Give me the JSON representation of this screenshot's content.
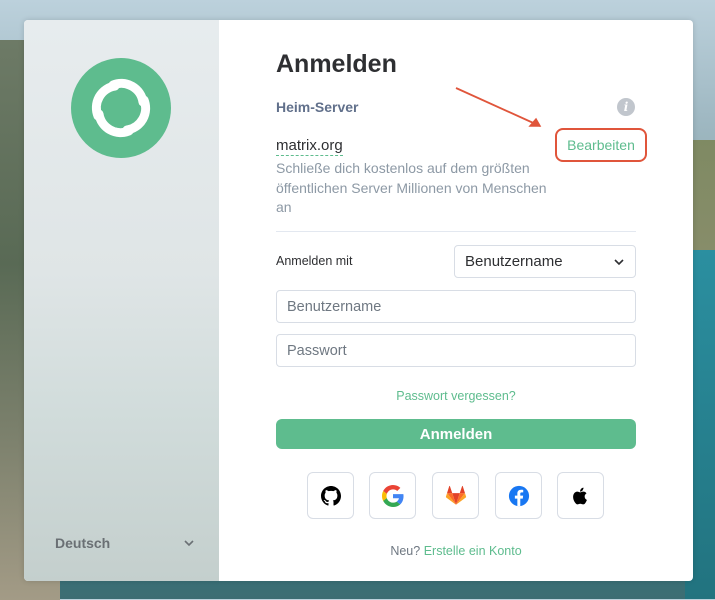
{
  "sidebar": {
    "logo_icon": "element-logo-icon",
    "language": "Deutsch"
  },
  "login": {
    "title": "Anmelden",
    "homeserver_label": "Heim-Server",
    "info_icon": "info-icon",
    "server_name": "matrix.org",
    "server_description": "Schließe dich kostenlos auf dem größten öffentlichen Server Millionen von Menschen an",
    "edit_label": "Bearbeiten",
    "login_with_label": "Anmelden mit",
    "login_method": "Benutzername",
    "username_placeholder": "Benutzername",
    "password_placeholder": "Passwort",
    "forgot_password": "Passwort vergessen?",
    "submit_label": "Anmelden",
    "sso_providers": [
      "github-icon",
      "google-icon",
      "gitlab-icon",
      "facebook-icon",
      "apple-icon"
    ],
    "register_prefix": "Neu?",
    "register_link": "Erstelle ein Konto"
  },
  "colors": {
    "accent": "#5ebc8e",
    "highlight": "#e0553b"
  }
}
